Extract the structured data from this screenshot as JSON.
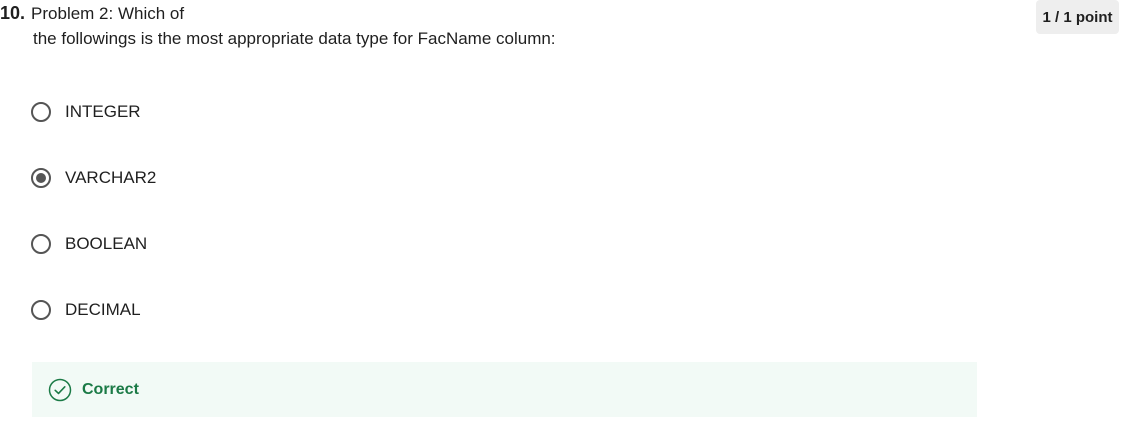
{
  "question": {
    "number": "10.",
    "text_line1": "Problem 2: Which of",
    "text_line2": "the followings is the most appropriate data type for FacName column:"
  },
  "score": {
    "label": "1 / 1 point"
  },
  "options": [
    {
      "label": "INTEGER",
      "selected": false
    },
    {
      "label": "VARCHAR2",
      "selected": true
    },
    {
      "label": "BOOLEAN",
      "selected": false
    },
    {
      "label": "DECIMAL",
      "selected": false
    }
  ],
  "feedback": {
    "label": "Correct",
    "icon": "check-circle-icon",
    "color": "#1b7a46",
    "background": "#f2faf6"
  }
}
